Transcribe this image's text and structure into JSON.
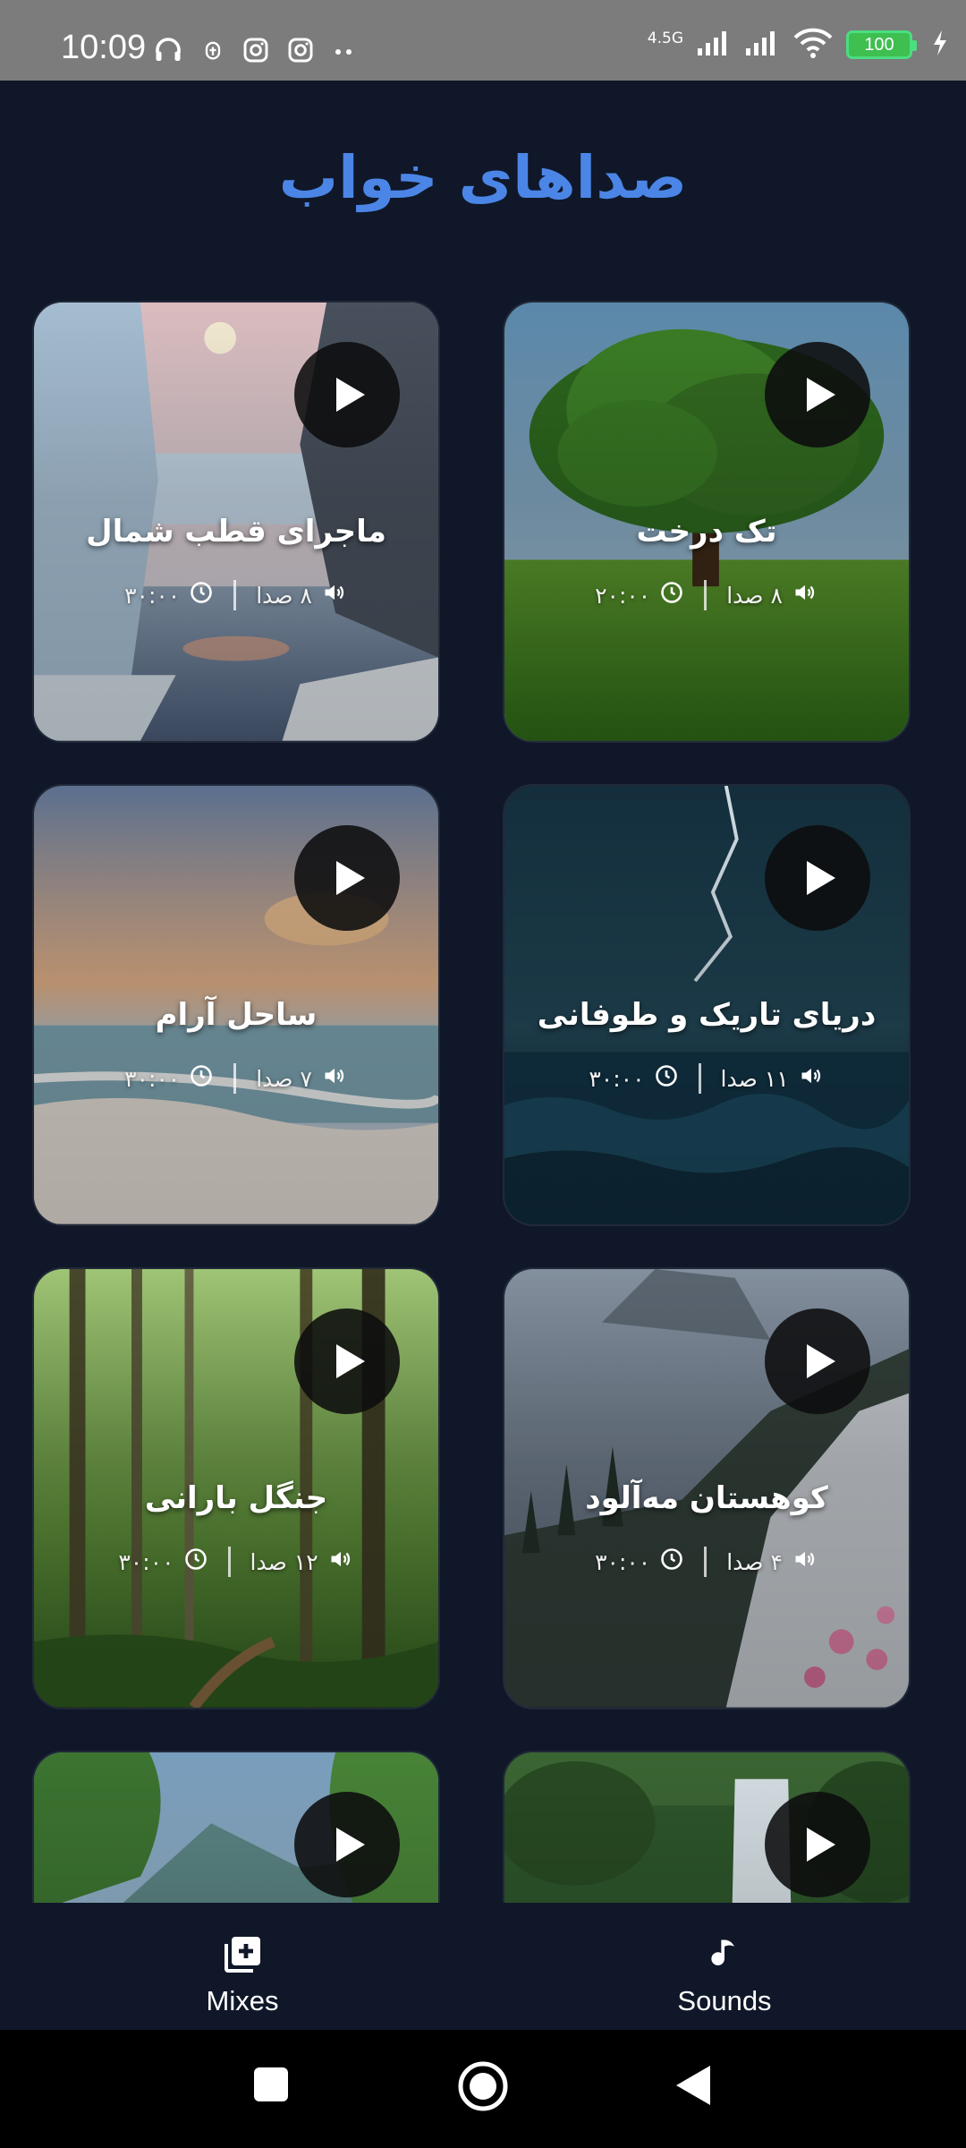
{
  "status_bar": {
    "time": "10:09",
    "network": "4.5G",
    "battery": "100",
    "left_icons": [
      "headphones-icon",
      "bug-icon",
      "instagram-icon",
      "instagram-icon",
      "more-dots-icon"
    ],
    "right_icons": [
      "signal-icon",
      "signal-icon",
      "wifi-icon",
      "battery-icon",
      "charging-icon"
    ]
  },
  "page": {
    "title": "صداهای خواب"
  },
  "cards": [
    {
      "title": "تک درخت",
      "sounds": "۸ صدا",
      "duration": "۲۰:۰۰",
      "scene": "tree-field"
    },
    {
      "title": "ماجرای قطب شمال",
      "sounds": "۸ صدا",
      "duration": "۳۰:۰۰",
      "scene": "arctic-glacier"
    },
    {
      "title": "دریای تاریک و طوفانی",
      "sounds": "۱۱ صدا",
      "duration": "۳۰:۰۰",
      "scene": "stormy-sea"
    },
    {
      "title": "ساحل آرام",
      "sounds": "۷ صدا",
      "duration": "۳۰:۰۰",
      "scene": "calm-beach"
    },
    {
      "title": "کوهستان مه‌آلود",
      "sounds": "۴ صدا",
      "duration": "۳۰:۰۰",
      "scene": "misty-mountain"
    },
    {
      "title": "جنگل بارانی",
      "sounds": "۱۲ صدا",
      "duration": "۳۰:۰۰",
      "scene": "rain-forest"
    },
    {
      "title": "",
      "sounds": "",
      "duration": "",
      "scene": "waterfall"
    },
    {
      "title": "",
      "sounds": "",
      "duration": "",
      "scene": "mountain-lake"
    }
  ],
  "bottom_nav": {
    "sounds_label": "Sounds",
    "mixes_label": "Mixes"
  },
  "colors": {
    "background": "#0f1729",
    "title_blue": "#4b85e6",
    "status_bar": "#7c7c7c",
    "battery_green": "#3fbf50"
  }
}
